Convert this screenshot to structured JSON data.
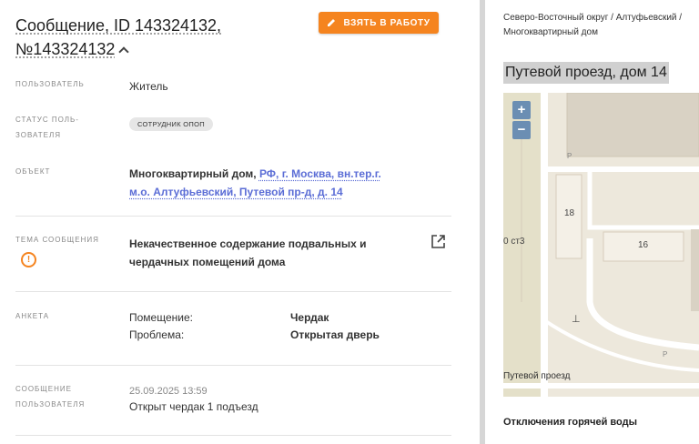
{
  "ticket": {
    "title": "Сообщение, ID 143324132, №143324132",
    "take_button": "ВЗЯТЬ В РАБОТУ"
  },
  "fields": {
    "user_label": "ПОЛЬЗОВАТЕЛЬ",
    "user_value": "Житель",
    "status_label": "СТАТУС ПОЛЬ-ЗОВАТЕЛЯ",
    "status_value": "СОТРУДНИК ОПОП",
    "object_label": "ОБЪЕКТ",
    "object_type": "Многоквартирный дом,",
    "object_address": "РФ, г. Москва, вн.тер.г. м.о. Алтуфьевский, Путевой пр-д, д. 14",
    "topic_label": "ТЕМА СООБЩЕНИЯ",
    "topic_value": "Некачественное содержание подвальных и чердачных помещений дома",
    "form_label": "АНКЕТА",
    "form_rows": [
      {
        "key": "Помещение:",
        "value": "Чердак"
      },
      {
        "key": "Проблема:",
        "value": "Открытая дверь"
      }
    ],
    "message_label": "СООБЩЕНИЕ ПОЛЬЗОВАТЕЛЯ",
    "message_date": "25.09.2025 13:59",
    "message_text": "Открыт чердак 1 подъезд"
  },
  "sidebar": {
    "breadcrumb": "Северо-Восточный округ / Алтуфьевский / Многоквартирный дом",
    "address": "Путевой проезд, дом 14",
    "map": {
      "zoom_in": "+",
      "zoom_out": "−",
      "building_18": "18",
      "building_16": "16",
      "label_ct3": "0 ст3",
      "street": "Путевой проезд",
      "parking": "P"
    },
    "hot_water": "Отключения горячей воды"
  },
  "colors": {
    "accent": "#f5841f",
    "link": "#5b6dd6",
    "map_bg": "#ede8dc"
  }
}
